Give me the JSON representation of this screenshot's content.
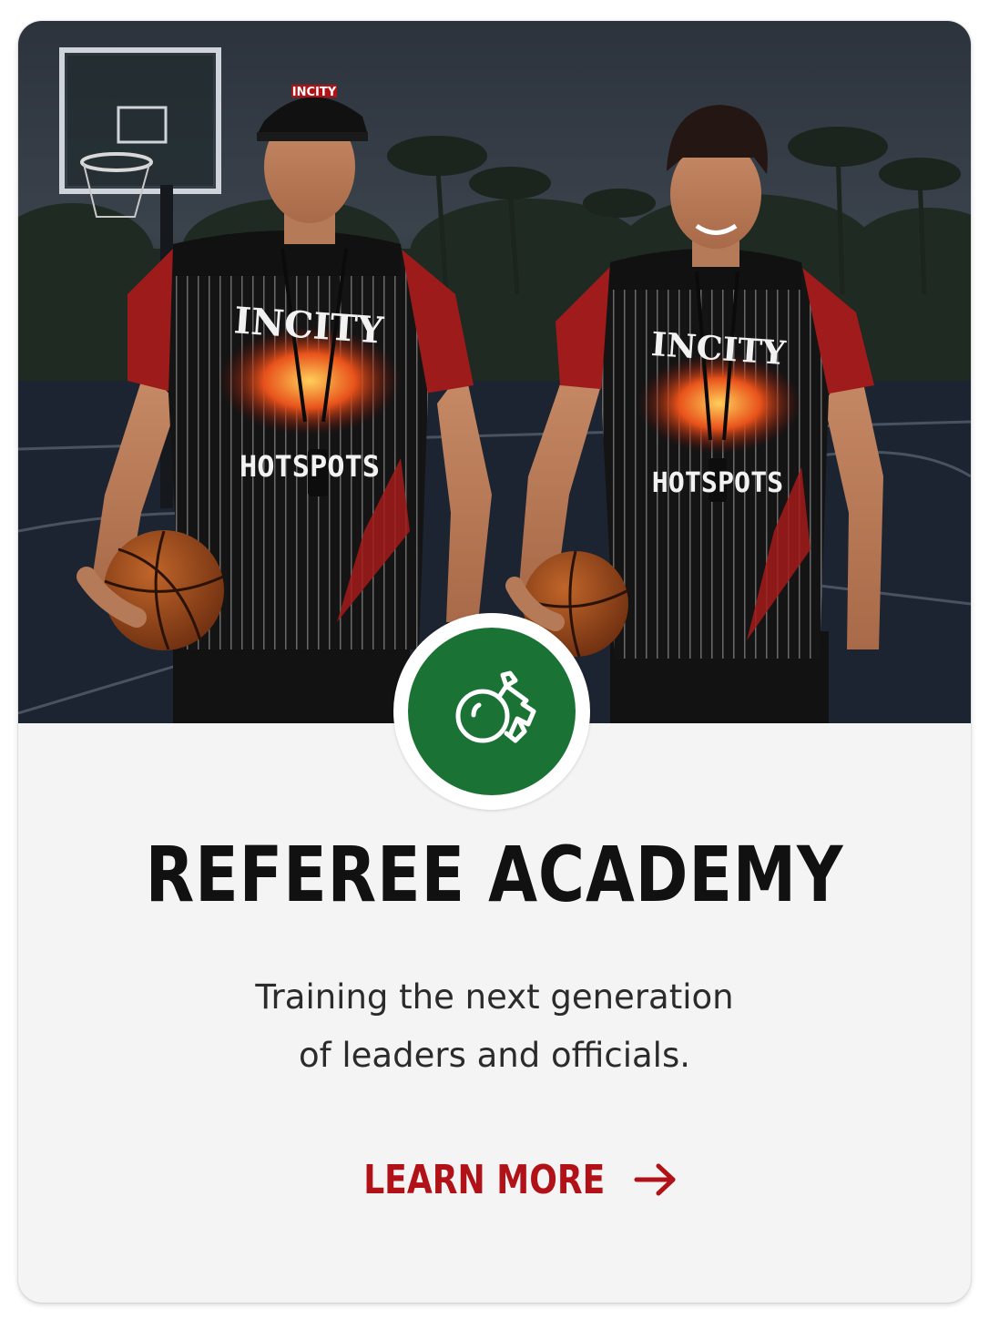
{
  "card": {
    "title": "REFEREE ACADEMY",
    "subtitle_line1": "Training the next generation",
    "subtitle_line2": "of leaders and officials.",
    "cta_label": "LEARN MORE",
    "icons": {
      "badge": "whistle-icon",
      "cta": "arrow-right-icon"
    },
    "colors": {
      "badge_green": "#1a7334",
      "cta_red": "#b01217",
      "title_text": "#111111",
      "card_bg": "#f4f4f4"
    }
  },
  "photo": {
    "jersey_word_top": "INCITY",
    "jersey_word_bottom": "HOTSPOTS",
    "cap_text": "INCITY"
  }
}
